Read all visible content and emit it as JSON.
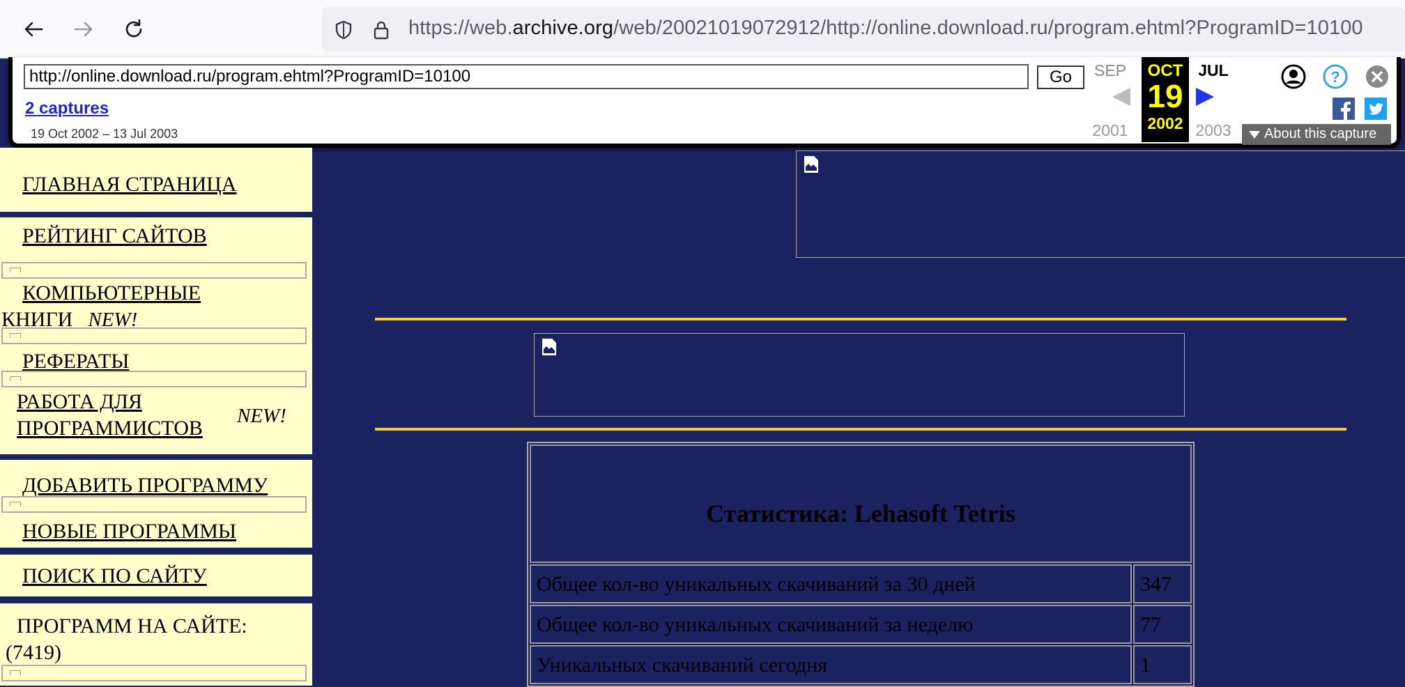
{
  "browser": {
    "url_prefix": "https://web.",
    "url_domain": "archive.org",
    "url_rest": "/web/20021019072912/http://online.download.ru/program.ehtml?ProgramID=10100"
  },
  "wayback": {
    "url_value": "http://online.download.ru/program.ehtml?ProgramID=10100",
    "go_label": "Go",
    "captures_label": "2 captures",
    "range_label": "19 Oct 2002 – 13 Jul 2003",
    "prev_month": "SEP",
    "prev_year": "2001",
    "cur_month": "OCT",
    "cur_day": "19",
    "cur_year": "2002",
    "next_month": "JUL",
    "next_year": "2003",
    "about_label": "About this capture"
  },
  "sidebar": {
    "items": [
      {
        "label": "ГЛАВНАЯ СТРАНИЦА"
      },
      {
        "label": "РЕЙТИНГ САЙТОВ"
      },
      {
        "label_1": "КОМПЬЮТЕРНЫЕ",
        "label_2": "КНИГИ",
        "badge": "NEW!"
      },
      {
        "label": "РЕФЕРАТЫ"
      },
      {
        "label_1": "РАБОТА ДЛЯ",
        "label_2": "ПРОГРАММИСТОВ",
        "badge": "NEW!"
      },
      {
        "label": "ДОБАВИТЬ ПРОГРАММУ"
      },
      {
        "label": "НОВЫЕ ПРОГРАММЫ"
      },
      {
        "label": "ПОИСК ПО САЙТУ"
      },
      {
        "label_1": "ПРОГРАММ НА САЙТЕ:",
        "label_2": "(7419)"
      }
    ]
  },
  "stats": {
    "title": "Статистика: Lehasoft Tetris",
    "rows": [
      {
        "label": "Общее кол-во уникальных скачиваний за 30 дней",
        "value": "347"
      },
      {
        "label": "Общее кол-во уникальных скачиваний за неделю",
        "value": "77"
      },
      {
        "label": "Уникальных скачиваний сегодня",
        "value": "1"
      }
    ]
  },
  "colors": {
    "page_bg": "#1b2260",
    "sidebar_bg": "#ffffcc",
    "rule": "#f0d040",
    "wayback_highlight": "#ffff00"
  }
}
